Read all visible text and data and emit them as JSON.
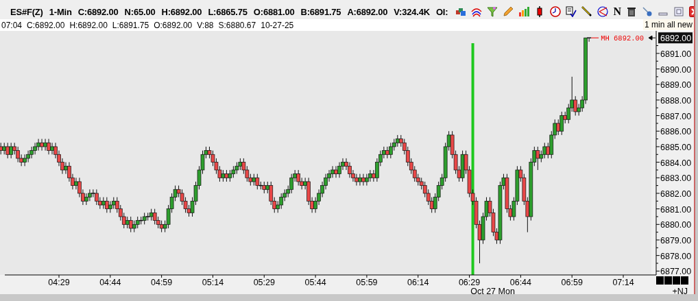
{
  "title_bar": {
    "symbol": "ES#F(Z)",
    "interval": "1-Min",
    "stats": [
      "C:6892.00",
      "N:65.00",
      "H:6892.00",
      "L:6865.75",
      "O:6881.00",
      "B:6891.75",
      "A:6892.00",
      "V:324.4K",
      "OI:"
    ],
    "letter_tool": "N"
  },
  "info_bar": {
    "items": [
      "07:04",
      "C:6892.00",
      "H:6892.00",
      "L:6891.75",
      "O:6892.00",
      "V:88",
      "S:6880.67",
      "10-27-25"
    ],
    "tooltip": "1 min all new"
  },
  "chart": {
    "chart_data": {
      "type": "candlestick",
      "ylim": [
        6876.75,
        6892.45
      ],
      "categories": [
        null,
        null,
        null,
        null,
        null,
        null,
        null,
        null,
        null,
        null,
        null,
        null,
        null,
        null,
        null,
        null,
        null,
        "04:29",
        null,
        null,
        null,
        null,
        null,
        null,
        null,
        null,
        null,
        null,
        null,
        null,
        null,
        null,
        "04:44",
        null,
        null,
        null,
        null,
        null,
        null,
        null,
        null,
        null,
        null,
        null,
        null,
        null,
        null,
        "04:59",
        null,
        null,
        null,
        null,
        null,
        null,
        null,
        null,
        null,
        null,
        null,
        null,
        null,
        null,
        "05:14",
        null,
        null,
        null,
        null,
        null,
        null,
        null,
        null,
        null,
        null,
        null,
        null,
        null,
        null,
        "05:29",
        null,
        null,
        null,
        null,
        null,
        null,
        null,
        null,
        null,
        null,
        null,
        null,
        null,
        null,
        "05:44",
        null,
        null,
        null,
        null,
        null,
        null,
        null,
        null,
        null,
        null,
        null,
        null,
        null,
        null,
        "05:59",
        null,
        null,
        null,
        null,
        null,
        null,
        null,
        null,
        null,
        null,
        null,
        null,
        null,
        null,
        "06:14",
        null,
        null,
        null,
        null,
        null,
        null,
        null,
        null,
        null,
        null,
        null,
        null,
        null,
        null,
        "06:29",
        null,
        null,
        null,
        null,
        null,
        null,
        null,
        null,
        null,
        null,
        null,
        null,
        null,
        null,
        "06:44",
        null,
        null,
        null,
        null,
        null,
        null,
        null,
        null,
        null,
        null,
        null,
        null,
        null,
        null,
        "06:59",
        null,
        null,
        null,
        null,
        null,
        null,
        null,
        null,
        null,
        null,
        null,
        null,
        null,
        null,
        "07:14"
      ],
      "ohlc": [
        [
          6885,
          6885.25,
          6884.5,
          6884.75
        ],
        [
          6884.75,
          6885.25,
          6884.5,
          6885
        ],
        [
          6885,
          6885.25,
          6884.25,
          6884.5
        ],
        [
          6884.5,
          6885.25,
          6884.25,
          6885
        ],
        [
          6885,
          6885.25,
          6884.5,
          6884.75
        ],
        [
          6884.75,
          6885,
          6884,
          6884.25
        ],
        [
          6884.25,
          6884.5,
          6883.75,
          6884
        ],
        [
          6884,
          6884.5,
          6883.75,
          6884.25
        ],
        [
          6884.25,
          6884.75,
          6884,
          6884.5
        ],
        [
          6884.5,
          6885,
          6884.25,
          6884.75
        ],
        [
          6884.75,
          6885.25,
          6884.5,
          6885
        ],
        [
          6885,
          6885.5,
          6884.75,
          6885.25
        ],
        [
          6885.25,
          6885.5,
          6884.75,
          6885
        ],
        [
          6885,
          6885.5,
          6884.75,
          6885.25
        ],
        [
          6885.25,
          6885.5,
          6884.5,
          6884.75
        ],
        [
          6884.75,
          6885.25,
          6884.5,
          6885
        ],
        [
          6885,
          6885.25,
          6884.25,
          6884.5
        ],
        [
          6884.5,
          6884.75,
          6883.75,
          6884
        ],
        [
          6884,
          6884.25,
          6883.25,
          6883.5
        ],
        [
          6883.5,
          6884,
          6883.25,
          6883.75
        ],
        [
          6883.75,
          6884,
          6882.75,
          6883
        ],
        [
          6883,
          6883.25,
          6882.25,
          6882.5
        ],
        [
          6882.5,
          6883,
          6882.25,
          6882.75
        ],
        [
          6882.75,
          6883,
          6881.75,
          6882
        ],
        [
          6882,
          6882.25,
          6881.25,
          6881.5
        ],
        [
          6881.5,
          6882,
          6881.25,
          6881.75
        ],
        [
          6881.75,
          6882.25,
          6881.5,
          6882
        ],
        [
          6882,
          6882.25,
          6881.75,
          6882
        ],
        [
          6882,
          6882.25,
          6881.25,
          6881.5
        ],
        [
          6881.5,
          6881.75,
          6881,
          6881.25
        ],
        [
          6881.25,
          6881.75,
          6881,
          6881.5
        ],
        [
          6881.5,
          6881.75,
          6880.75,
          6881
        ],
        [
          6881,
          6881.5,
          6880.75,
          6881.25
        ],
        [
          6881.25,
          6881.75,
          6881,
          6881.5
        ],
        [
          6881.5,
          6881.75,
          6880.75,
          6881
        ],
        [
          6881,
          6881.25,
          6880.25,
          6880.5
        ],
        [
          6880.5,
          6880.75,
          6879.75,
          6880
        ],
        [
          6880,
          6880.5,
          6879.75,
          6880.25
        ],
        [
          6880.25,
          6880.5,
          6879.5,
          6879.75
        ],
        [
          6879.75,
          6880.25,
          6879.5,
          6880
        ],
        [
          6880,
          6880.5,
          6879.75,
          6880.25
        ],
        [
          6880.25,
          6880.5,
          6880,
          6880.25
        ],
        [
          6880.25,
          6880.75,
          6880,
          6880.5
        ],
        [
          6880.5,
          6880.75,
          6880.25,
          6880.5
        ],
        [
          6880.5,
          6881,
          6880.25,
          6880.75
        ],
        [
          6880.75,
          6881,
          6880,
          6880.25
        ],
        [
          6880.25,
          6880.5,
          6879.75,
          6880
        ],
        [
          6880,
          6880.25,
          6879.5,
          6879.75
        ],
        [
          6879.75,
          6880.25,
          6879.5,
          6880
        ],
        [
          6880,
          6881.25,
          6879.75,
          6881
        ],
        [
          6881,
          6882,
          6880.75,
          6881.75
        ],
        [
          6881.75,
          6882.5,
          6881.5,
          6882.25
        ],
        [
          6882.25,
          6882.5,
          6881.75,
          6882
        ],
        [
          6882,
          6882.25,
          6881.25,
          6881.5
        ],
        [
          6881.5,
          6881.75,
          6880.75,
          6881
        ],
        [
          6881,
          6881.25,
          6880.5,
          6880.75
        ],
        [
          6880.75,
          6881.75,
          6880.5,
          6881.5
        ],
        [
          6881.5,
          6882.75,
          6881.25,
          6882.5
        ],
        [
          6882.5,
          6883.75,
          6882.25,
          6883.5
        ],
        [
          6883.5,
          6884.75,
          6883.25,
          6884.5
        ],
        [
          6884.5,
          6885,
          6884.25,
          6884.75
        ],
        [
          6884.75,
          6885,
          6884.25,
          6884.5
        ],
        [
          6884.5,
          6884.75,
          6883.75,
          6884
        ],
        [
          6884,
          6884.25,
          6883.25,
          6883.5
        ],
        [
          6883.5,
          6883.75,
          6882.75,
          6883
        ],
        [
          6883,
          6883.5,
          6882.75,
          6883.25
        ],
        [
          6883.25,
          6883.5,
          6882.75,
          6883
        ],
        [
          6883,
          6883.5,
          6882.75,
          6883.25
        ],
        [
          6883.25,
          6883.75,
          6883,
          6883.5
        ],
        [
          6883.5,
          6884,
          6883.25,
          6883.75
        ],
        [
          6883.75,
          6884.25,
          6883.5,
          6884
        ],
        [
          6884,
          6884.25,
          6883.25,
          6883.5
        ],
        [
          6883.5,
          6883.75,
          6882.75,
          6883
        ],
        [
          6883,
          6883.25,
          6882.5,
          6882.75
        ],
        [
          6882.75,
          6883.25,
          6882.5,
          6883
        ],
        [
          6883,
          6883.25,
          6882.25,
          6882.5
        ],
        [
          6882.5,
          6882.75,
          6882.25,
          6882.5
        ],
        [
          6882.5,
          6882.75,
          6882,
          6882.25
        ],
        [
          6882.25,
          6882.75,
          6882,
          6882.5
        ],
        [
          6882.5,
          6882.75,
          6881.25,
          6881.5
        ],
        [
          6881.5,
          6881.75,
          6880.75,
          6881
        ],
        [
          6881,
          6881.5,
          6880.75,
          6881.25
        ],
        [
          6881.25,
          6882,
          6881,
          6881.75
        ],
        [
          6881.75,
          6882.25,
          6881.5,
          6882
        ],
        [
          6882,
          6882.5,
          6881.75,
          6882.25
        ],
        [
          6882.25,
          6883.25,
          6882,
          6883
        ],
        [
          6883,
          6883.5,
          6882.75,
          6883.25
        ],
        [
          6883.25,
          6883.5,
          6882.5,
          6882.75
        ],
        [
          6882.75,
          6883,
          6882.25,
          6882.5
        ],
        [
          6882.5,
          6883,
          6882.25,
          6882.75
        ],
        [
          6882.75,
          6883,
          6881.25,
          6881.5
        ],
        [
          6881.5,
          6881.75,
          6880.75,
          6881
        ],
        [
          6881,
          6881.75,
          6880.75,
          6881.5
        ],
        [
          6881.5,
          6882.25,
          6881.25,
          6882
        ],
        [
          6882,
          6882.75,
          6881.75,
          6882.5
        ],
        [
          6882.5,
          6883.25,
          6882.25,
          6883
        ],
        [
          6883,
          6883.5,
          6882.75,
          6883.25
        ],
        [
          6883.25,
          6883.75,
          6883,
          6883.5
        ],
        [
          6883.5,
          6883.75,
          6883,
          6883.25
        ],
        [
          6883.25,
          6884,
          6883,
          6883.75
        ],
        [
          6883.75,
          6884.25,
          6883.5,
          6884
        ],
        [
          6884,
          6884.25,
          6883.5,
          6883.75
        ],
        [
          6883.75,
          6884,
          6883,
          6883.25
        ],
        [
          6883.25,
          6883.5,
          6882.75,
          6883
        ],
        [
          6883,
          6883.25,
          6882.5,
          6882.75
        ],
        [
          6882.75,
          6883.25,
          6882.5,
          6883
        ],
        [
          6883,
          6883.25,
          6882.5,
          6882.75
        ],
        [
          6882.75,
          6883.25,
          6882.5,
          6883
        ],
        [
          6883,
          6883.5,
          6882.75,
          6883.25
        ],
        [
          6883.25,
          6883.5,
          6882.75,
          6883
        ],
        [
          6883,
          6884.25,
          6882.75,
          6884
        ],
        [
          6884,
          6884.75,
          6883.75,
          6884.5
        ],
        [
          6884.5,
          6885,
          6884.25,
          6884.75
        ],
        [
          6884.75,
          6885,
          6884.25,
          6884.5
        ],
        [
          6884.5,
          6885.25,
          6884.25,
          6885
        ],
        [
          6885,
          6885.5,
          6884.75,
          6885.25
        ],
        [
          6885.25,
          6885.75,
          6885,
          6885.5
        ],
        [
          6885.5,
          6885.75,
          6885,
          6885.25
        ],
        [
          6885.25,
          6885.5,
          6884.5,
          6884.75
        ],
        [
          6884.75,
          6885,
          6883.75,
          6884
        ],
        [
          6884,
          6884.25,
          6883.25,
          6883.5
        ],
        [
          6883.5,
          6883.75,
          6882.75,
          6883
        ],
        [
          6883,
          6883.25,
          6882.5,
          6882.75
        ],
        [
          6882.75,
          6883,
          6882.25,
          6882.5
        ],
        [
          6882.5,
          6882.75,
          6881.75,
          6882
        ],
        [
          6882,
          6882.25,
          6881.25,
          6881.5
        ],
        [
          6881.5,
          6881.75,
          6880.75,
          6881
        ],
        [
          6881,
          6882,
          6880.75,
          6881.75
        ],
        [
          6881.75,
          6882.75,
          6881.5,
          6882.5
        ],
        [
          6882.5,
          6883.25,
          6882.25,
          6883
        ],
        [
          6883,
          6885.25,
          6882.75,
          6885
        ],
        [
          6885,
          6886,
          6884.75,
          6885.75
        ],
        [
          6885.75,
          6886,
          6884.25,
          6884.5
        ],
        [
          6884.5,
          6884.75,
          6883.25,
          6883.5
        ],
        [
          6883.5,
          6883.75,
          6882.75,
          6883
        ],
        [
          6883,
          6884.75,
          6882.75,
          6884.5
        ],
        [
          6884.5,
          6884.75,
          6883.25,
          6883.5
        ],
        [
          6883.5,
          6883.75,
          6881.75,
          6882
        ],
        [
          6882,
          6882.25,
          6881.25,
          6881.5
        ],
        [
          6881.5,
          6881.75,
          6879.75,
          6880
        ],
        [
          6880,
          6880.25,
          6877.5,
          6879
        ],
        [
          6879,
          6880.75,
          6878.75,
          6880.5
        ],
        [
          6880.5,
          6881.75,
          6880.25,
          6881.5
        ],
        [
          6881.5,
          6881.75,
          6880.5,
          6880.75
        ],
        [
          6880.75,
          6881,
          6879.25,
          6879.5
        ],
        [
          6879.5,
          6879.75,
          6878.75,
          6879
        ],
        [
          6879,
          6882.75,
          6878.75,
          6882.5
        ],
        [
          6882.5,
          6883.25,
          6882.25,
          6883
        ],
        [
          6883,
          6883.25,
          6880.75,
          6881
        ],
        [
          6881,
          6881.25,
          6880.25,
          6880.5
        ],
        [
          6880.5,
          6881.75,
          6880.25,
          6881.5
        ],
        [
          6881.5,
          6883.75,
          6881.25,
          6883.5
        ],
        [
          6883.5,
          6883.75,
          6882.75,
          6883
        ],
        [
          6883,
          6883.25,
          6881.25,
          6881.5
        ],
        [
          6881.5,
          6881.75,
          6879.5,
          6880.5
        ],
        [
          6880.5,
          6884.25,
          6880.25,
          6884
        ],
        [
          6884,
          6885,
          6883.75,
          6884.75
        ],
        [
          6884.75,
          6885,
          6883.5,
          6884.25
        ],
        [
          6884.25,
          6884.75,
          6884,
          6884.5
        ],
        [
          6884.5,
          6885.25,
          6884.25,
          6885
        ],
        [
          6885,
          6885.25,
          6884.25,
          6884.5
        ],
        [
          6884.5,
          6886,
          6884.25,
          6885.75
        ],
        [
          6885.75,
          6886.75,
          6885.5,
          6886.5
        ],
        [
          6886.5,
          6886.75,
          6885.75,
          6886
        ],
        [
          6886,
          6887.25,
          6885.75,
          6887
        ],
        [
          6887,
          6887.25,
          6886.5,
          6886.75
        ],
        [
          6886.75,
          6887.75,
          6886.5,
          6887.5
        ],
        [
          6887.5,
          6889.5,
          6887.25,
          6888
        ],
        [
          6888,
          6888.25,
          6887,
          6887.25
        ],
        [
          6887.25,
          6887.75,
          6887,
          6887.5
        ],
        [
          6887.5,
          6888.25,
          6887.25,
          6888
        ],
        [
          6888,
          6892,
          6887.75,
          6892
        ],
        [
          6892,
          6892,
          6891.75,
          6892
        ],
        null,
        null,
        null,
        null,
        null,
        null,
        null,
        null,
        null,
        null
      ],
      "yticks": [
        {
          "value": 6877,
          "label": "6877.00"
        },
        {
          "value": 6878,
          "label": "6878.00"
        },
        {
          "value": 6879,
          "label": "6879.00"
        },
        {
          "value": 6880,
          "label": "6880.00"
        },
        {
          "value": 6881,
          "label": "6881.00"
        },
        {
          "value": 6882,
          "label": "6882.00"
        },
        {
          "value": 6883,
          "label": "6883.00"
        },
        {
          "value": 6884,
          "label": "6884.00"
        },
        {
          "value": 6885,
          "label": "6885.00"
        },
        {
          "value": 6886,
          "label": "6886.00"
        },
        {
          "value": 6887,
          "label": "6887.00"
        },
        {
          "value": 6888,
          "label": "6888.00"
        },
        {
          "value": 6889,
          "label": "6889.00"
        },
        {
          "value": 6890,
          "label": "6890.00"
        },
        {
          "value": 6891,
          "label": "6891.00"
        }
      ]
    },
    "marker_label": "MH 6892.00",
    "last_price": "6892.00",
    "date_label": "Oct 27 Mon",
    "corner_label": "+NJ"
  }
}
